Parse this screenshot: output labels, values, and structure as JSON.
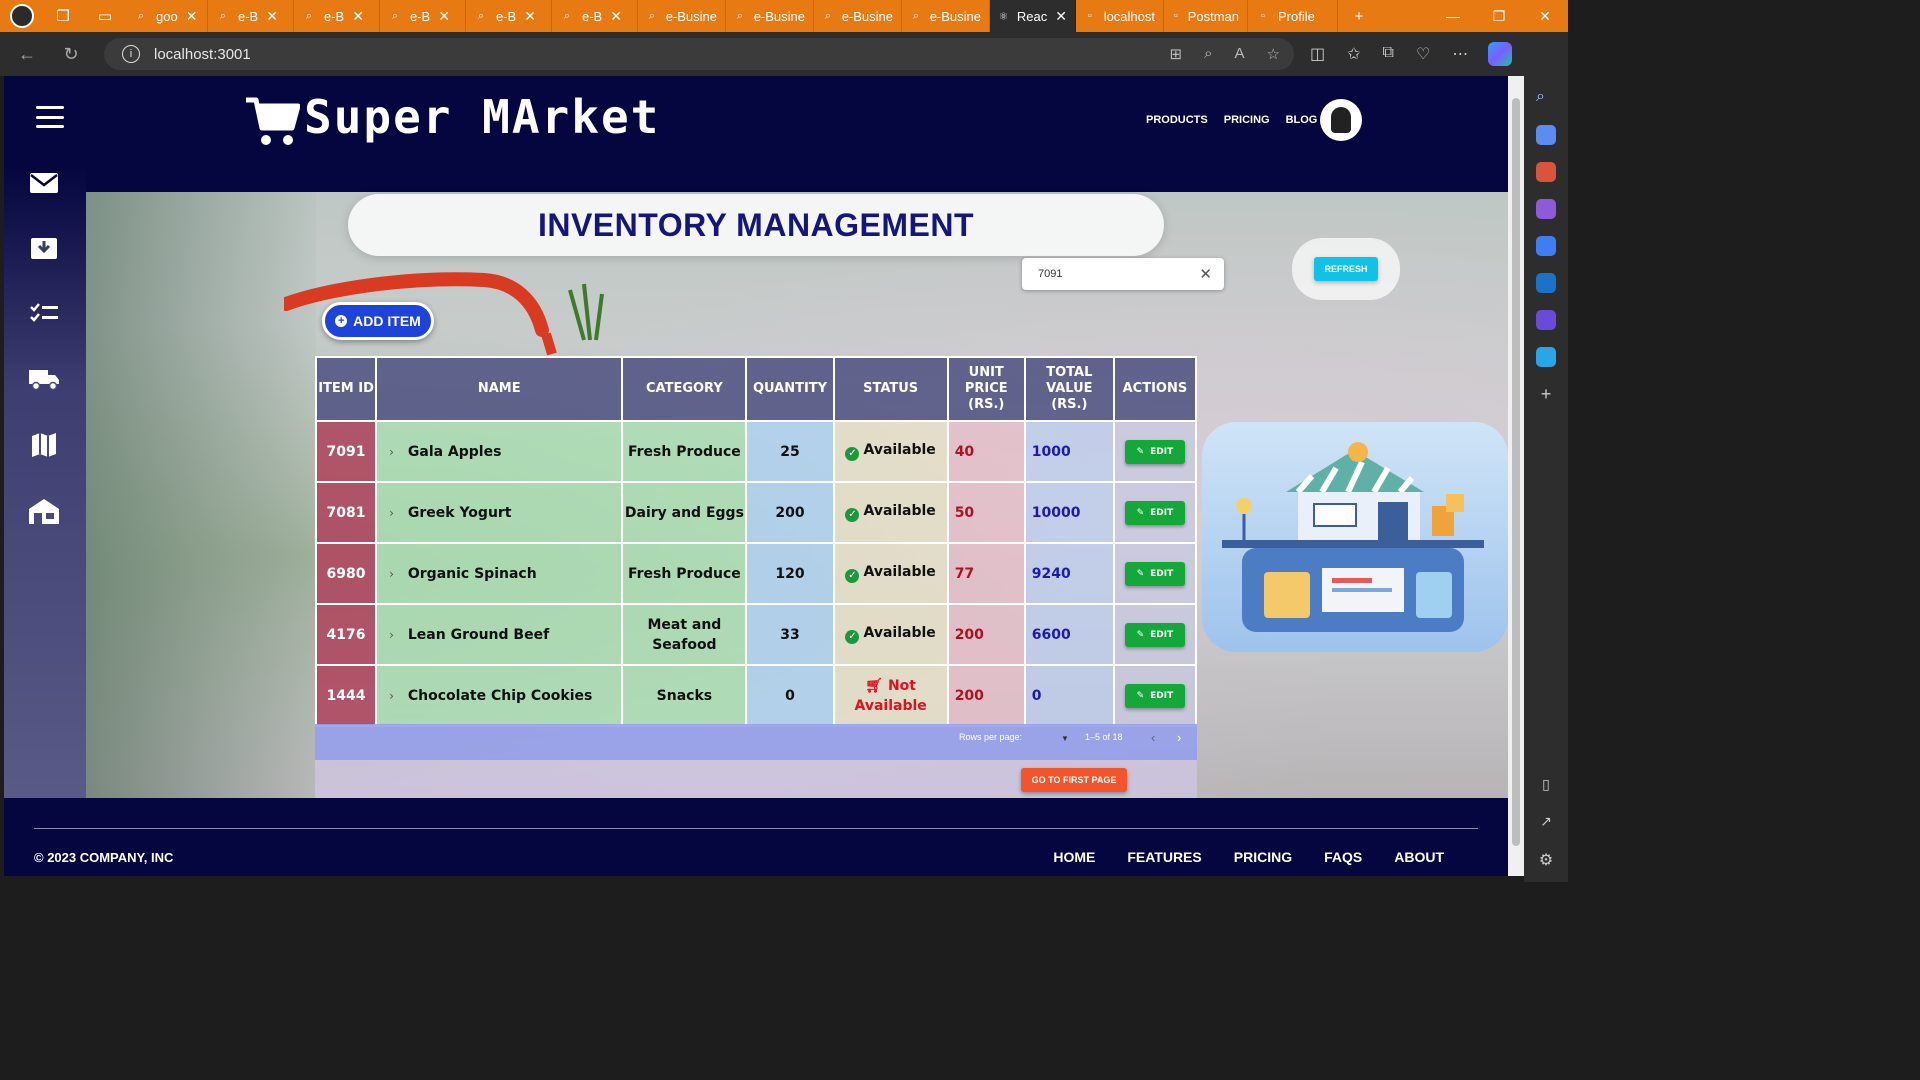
{
  "browser": {
    "tabs": [
      {
        "label": "goo"
      },
      {
        "label": "e-B"
      },
      {
        "label": "e-B"
      },
      {
        "label": "e-B"
      },
      {
        "label": "e-B"
      },
      {
        "label": "e-B"
      },
      {
        "label": "e-Busine"
      },
      {
        "label": "e-Busine"
      },
      {
        "label": "e-Busine"
      },
      {
        "label": "e-Busine"
      },
      {
        "label": "Reac"
      },
      {
        "label": "localhost"
      },
      {
        "label": "Postman"
      },
      {
        "label": "Profile"
      }
    ],
    "url": "localhost:3001"
  },
  "header": {
    "logo_text": "Super MArket",
    "nav": [
      "PRODUCTS",
      "PRICING",
      "BLOG"
    ]
  },
  "page": {
    "title": "INVENTORY MANAGEMENT",
    "search_value": "7091",
    "refresh_label": "REFRESH",
    "add_label": "ADD ITEM"
  },
  "table": {
    "columns": [
      "ITEM ID",
      "NAME",
      "CATEGORY",
      "QUANTITY",
      "STATUS",
      "UNIT PRICE (RS.)",
      "TOTAL VALUE (RS.)",
      "ACTIONS"
    ],
    "rows": [
      {
        "id": "7091",
        "name": "Gala Apples",
        "category": "Fresh Produce",
        "quantity": "25",
        "status": "Available",
        "available": true,
        "unit_price": "40",
        "total": "1000",
        "action": "EDIT"
      },
      {
        "id": "7081",
        "name": "Greek Yogurt",
        "category": "Dairy and Eggs",
        "quantity": "200",
        "status": "Available",
        "available": true,
        "unit_price": "50",
        "total": "10000",
        "action": "EDIT"
      },
      {
        "id": "6980",
        "name": "Organic Spinach",
        "category": "Fresh Produce",
        "quantity": "120",
        "status": "Available",
        "available": true,
        "unit_price": "77",
        "total": "9240",
        "action": "EDIT"
      },
      {
        "id": "4176",
        "name": "Lean Ground Beef",
        "category": "Meat and Seafood",
        "quantity": "33",
        "status": "Available",
        "available": true,
        "unit_price": "200",
        "total": "6600",
        "action": "EDIT"
      },
      {
        "id": "1444",
        "name": "Chocolate Chip Cookies",
        "category": "Snacks",
        "quantity": "0",
        "status": "Not Available",
        "available": false,
        "unit_price": "200",
        "total": "0",
        "action": "EDIT"
      }
    ]
  },
  "pagination": {
    "rows_per_page_label": "Rows per page:",
    "range": "1–5 of 18",
    "first_page_label": "GO TO FIRST PAGE"
  },
  "footer": {
    "copyright": "© 2023 COMPANY, INC",
    "links": [
      "HOME",
      "FEATURES",
      "PRICING",
      "FAQS",
      "ABOUT"
    ]
  },
  "colors": {
    "navy": "#05053f",
    "title": "#15157a",
    "refresh": "#10c2e6",
    "add": "#1e43d8",
    "edit": "#14a83a",
    "first_page": "#f2542b"
  }
}
